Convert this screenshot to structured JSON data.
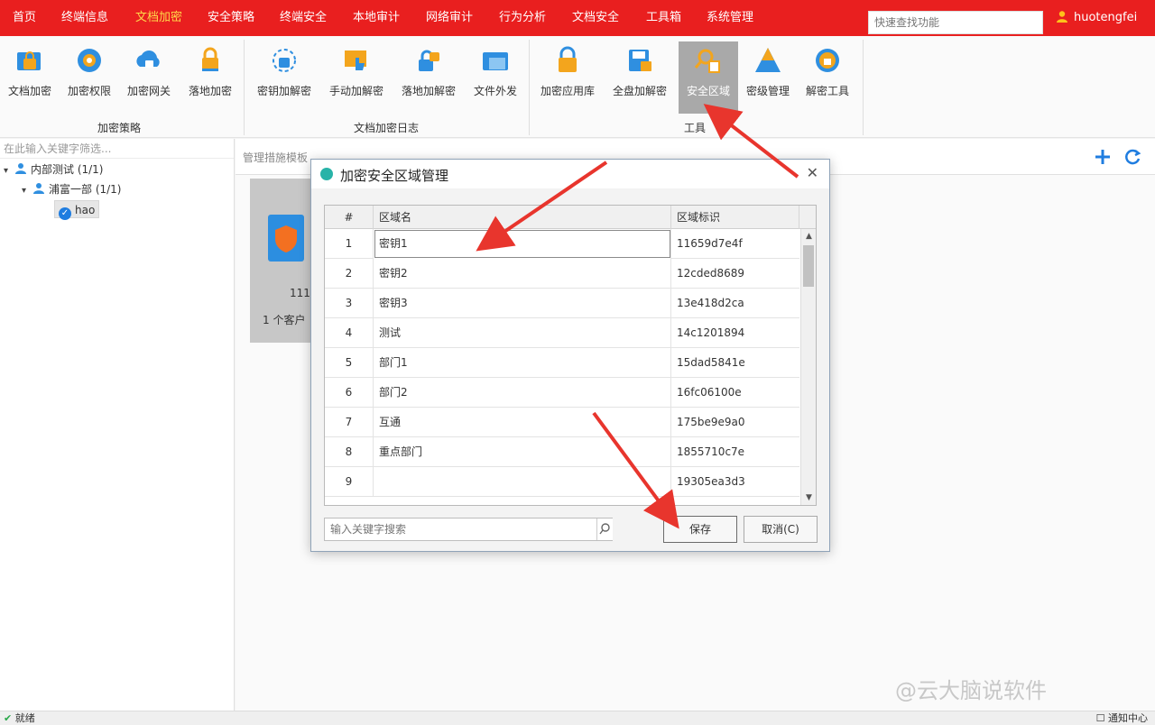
{
  "topnav": {
    "items": [
      "首页",
      "终端信息",
      "文档加密",
      "安全策略",
      "终端安全",
      "本地审计",
      "网络审计",
      "行为分析",
      "文档安全",
      "工具箱",
      "系统管理"
    ],
    "active_index": 2,
    "search_placeholder": "快速查找功能",
    "user_name": "huotengfei"
  },
  "ribbon": {
    "groups": [
      {
        "label": "加密策略",
        "buttons": [
          "文档加密",
          "加密权限",
          "加密网关",
          "落地加密"
        ]
      },
      {
        "label": "文档加密日志",
        "buttons": [
          "密钥加解密",
          "手动加解密",
          "落地加解密",
          "文件外发"
        ]
      },
      {
        "label": "工具",
        "buttons": [
          "加密应用库",
          "全盘加解密",
          "安全区域",
          "密级管理",
          "解密工具"
        ]
      }
    ],
    "active_button": "安全区域"
  },
  "left_panel": {
    "filter_placeholder": "在此输入关键字筛选...",
    "tree": {
      "root": "内部测试 (1/1)",
      "child": "浦富一部 (1/1)",
      "user": "hao"
    }
  },
  "main": {
    "header_text": "管理措施模板",
    "card_number": "111",
    "card_caption": "1 个客户"
  },
  "dialog": {
    "title": "加密安全区域管理",
    "columns": [
      "#",
      "区域名",
      "区域标识"
    ],
    "rows": [
      {
        "no": "1",
        "name": "密钥1",
        "id": "11659d7e4f"
      },
      {
        "no": "2",
        "name": "密钥2",
        "id": "12cded8689"
      },
      {
        "no": "3",
        "name": "密钥3",
        "id": "13e418d2ca"
      },
      {
        "no": "4",
        "name": "测试",
        "id": "14c1201894"
      },
      {
        "no": "5",
        "name": "部门1",
        "id": "15dad5841e"
      },
      {
        "no": "6",
        "name": "部门2",
        "id": "16fc06100e"
      },
      {
        "no": "7",
        "name": "互通",
        "id": "175be9e9a0"
      },
      {
        "no": "8",
        "name": "重点部门",
        "id": "1855710c7e"
      },
      {
        "no": "9",
        "name": "",
        "id": "19305ea3d3"
      }
    ],
    "search_placeholder": "输入关键字搜索",
    "save_label": "保存",
    "cancel_label": "取消(C)"
  },
  "statusbar": {
    "left": "就绪",
    "right": "通知中心"
  },
  "watermark": "@云大脑说软件",
  "colors": {
    "nav_bg": "#e91f1f",
    "nav_active": "#ffd84a",
    "arrow": "#e8352d"
  }
}
